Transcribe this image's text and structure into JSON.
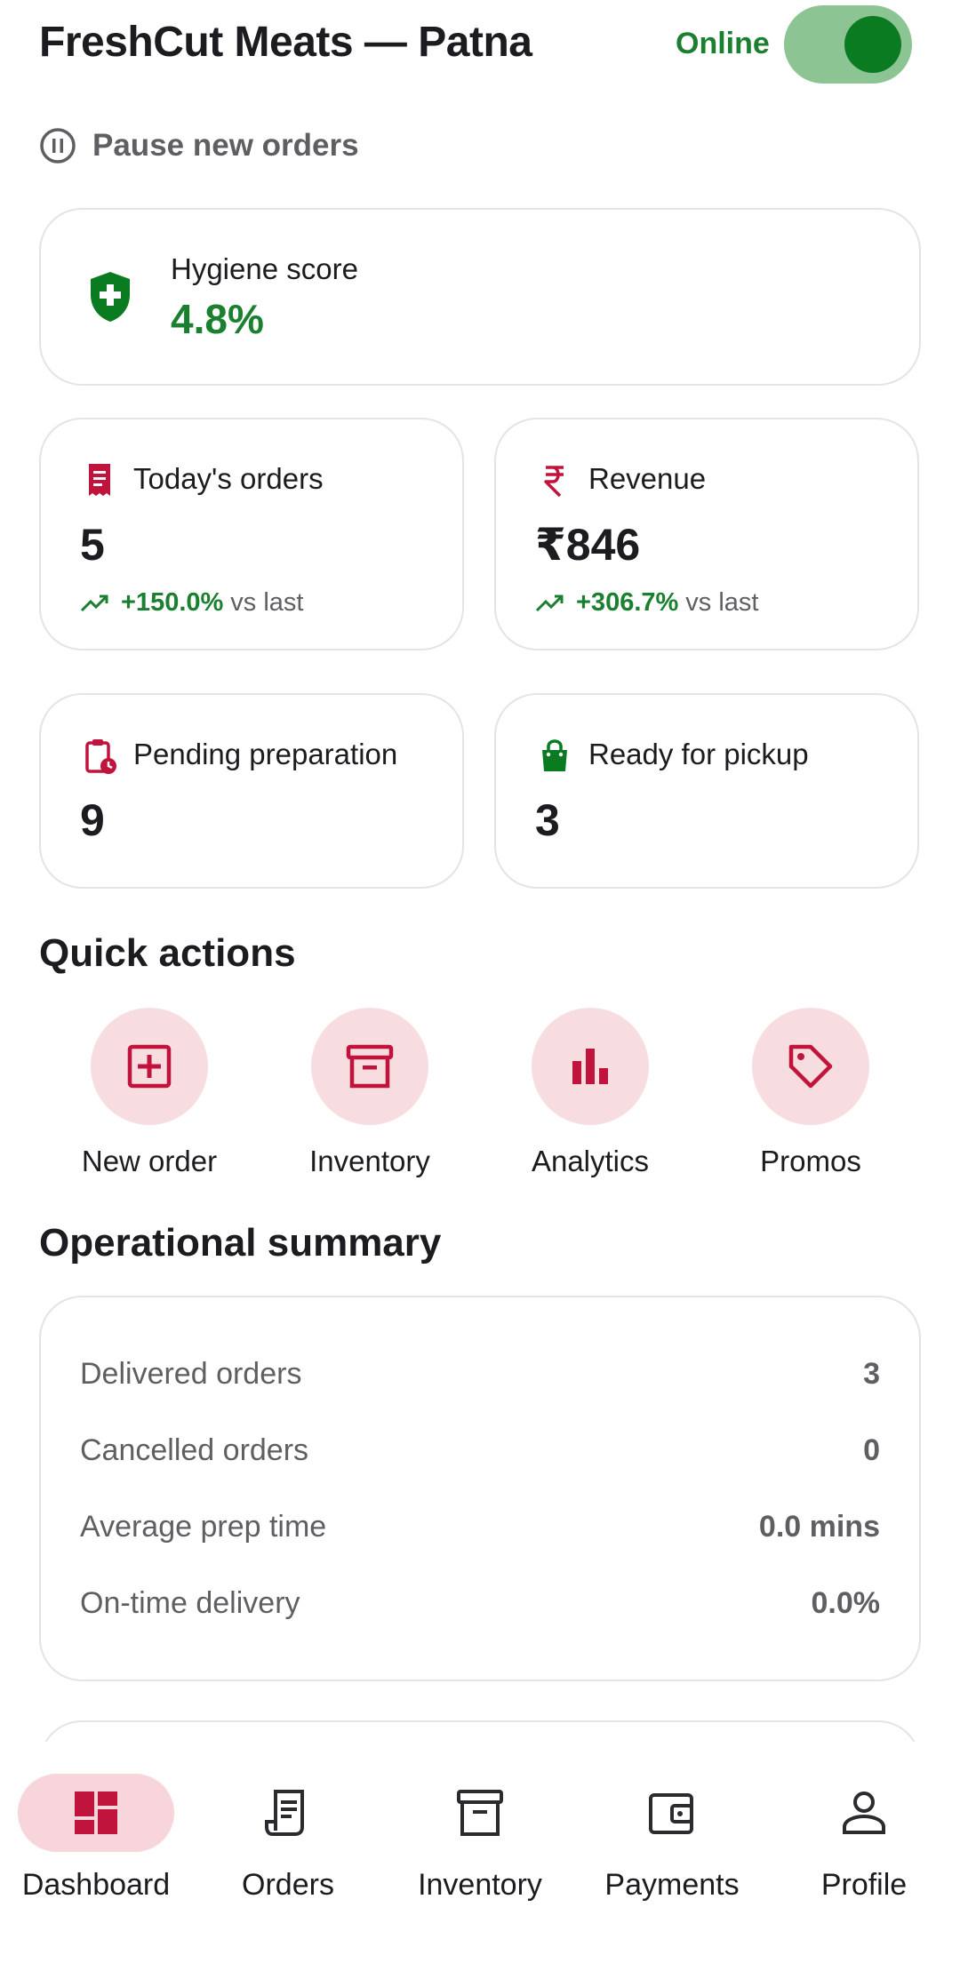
{
  "header": {
    "store_name": "FreshCut Meats — Patna",
    "status_label": "Online",
    "online": true,
    "pause_label": "Pause new orders"
  },
  "hygiene": {
    "label": "Hygiene score",
    "value": "4.8%"
  },
  "stats": {
    "today_orders": {
      "label": "Today's orders",
      "value": "5",
      "trend": "+150.0%",
      "trend_suffix": "vs last"
    },
    "revenue": {
      "label": "Revenue",
      "value": "₹846",
      "trend": "+306.7%",
      "trend_suffix": "vs last"
    },
    "pending": {
      "label": "Pending preparation",
      "value": "9"
    },
    "ready": {
      "label": "Ready for pickup",
      "value": "3"
    }
  },
  "quick_actions": {
    "title": "Quick actions",
    "items": [
      {
        "label": "New order",
        "icon": "add-box-icon"
      },
      {
        "label": "Inventory",
        "icon": "archive-box-icon"
      },
      {
        "label": "Analytics",
        "icon": "bar-chart-icon"
      },
      {
        "label": "Promos",
        "icon": "tag-icon"
      }
    ]
  },
  "summary": {
    "title": "Operational summary",
    "rows": [
      {
        "label": "Delivered orders",
        "value": "3"
      },
      {
        "label": "Cancelled orders",
        "value": "0"
      },
      {
        "label": "Average prep time",
        "value": "0.0 mins"
      },
      {
        "label": "On-time delivery",
        "value": "0.0%"
      }
    ]
  },
  "nav": {
    "items": [
      {
        "label": "Dashboard",
        "icon": "dashboard-icon",
        "active": true
      },
      {
        "label": "Orders",
        "icon": "receipt-icon",
        "active": false
      },
      {
        "label": "Inventory",
        "icon": "archive-box-icon",
        "active": false
      },
      {
        "label": "Payments",
        "icon": "wallet-icon",
        "active": false
      },
      {
        "label": "Profile",
        "icon": "person-icon",
        "active": false
      }
    ]
  },
  "colors": {
    "brand": "#c0143c",
    "success": "#1a7f2e",
    "accent_soft": "#f7dde0",
    "toggle_track": "#8dc493"
  }
}
